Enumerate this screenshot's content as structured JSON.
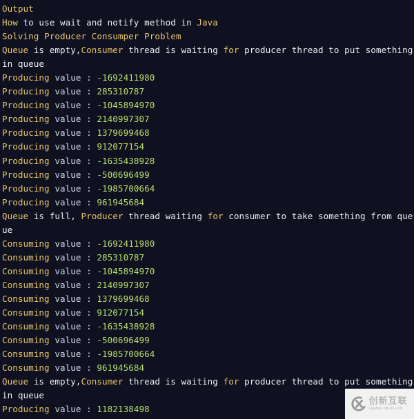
{
  "console": {
    "title": "Output",
    "heading_line": [
      {
        "text": "How",
        "style": "kw"
      },
      {
        "text": " to use wait and notify method in ",
        "style": "plain"
      },
      {
        "text": "Java",
        "style": "kw"
      }
    ],
    "subtitle": "Solving Producer Consumper Problem",
    "empty_msg": [
      {
        "text": "Queue",
        "style": "kw"
      },
      {
        "text": " is empty,",
        "style": "plain"
      },
      {
        "text": "Consumer",
        "style": "kw"
      },
      {
        "text": " thread is waiting ",
        "style": "plain"
      },
      {
        "text": "for",
        "style": "kw"
      },
      {
        "text": " producer thread to put something in queue",
        "style": "plain"
      }
    ],
    "full_msg": [
      {
        "text": "Queue",
        "style": "kw"
      },
      {
        "text": " is full, ",
        "style": "plain"
      },
      {
        "text": "Producer",
        "style": "kw"
      },
      {
        "text": " thread waiting ",
        "style": "plain"
      },
      {
        "text": "for",
        "style": "kw"
      },
      {
        "text": " consumer to take something from queue",
        "style": "plain"
      }
    ],
    "producing_label": "Producing",
    "consuming_label": "Consuming",
    "value_label": "value",
    "separator": " : ",
    "produced_values": [
      "-1692411980",
      "285310787",
      "-1045894970",
      "2140997307",
      "1379699468",
      "912077154",
      "-1635438928",
      "-500696499",
      "-1985700664",
      "961945684"
    ],
    "consumed_values": [
      "-1692411980",
      "285310787",
      "-1045894970",
      "2140997307",
      "1379699468",
      "912077154",
      "-1635438928",
      "-500696499",
      "-1985700664",
      "961945684"
    ],
    "final_produced_value": "1182138498"
  },
  "watermark": {
    "text_cn": "创新互联",
    "text_en": "CHUANG XIN HU LIAN",
    "icon": "brand-logo-icon"
  },
  "colors": {
    "background": "#0f1120",
    "keyword": "#e8c46a",
    "number": "#b8de6e",
    "text": "#eceef2"
  }
}
